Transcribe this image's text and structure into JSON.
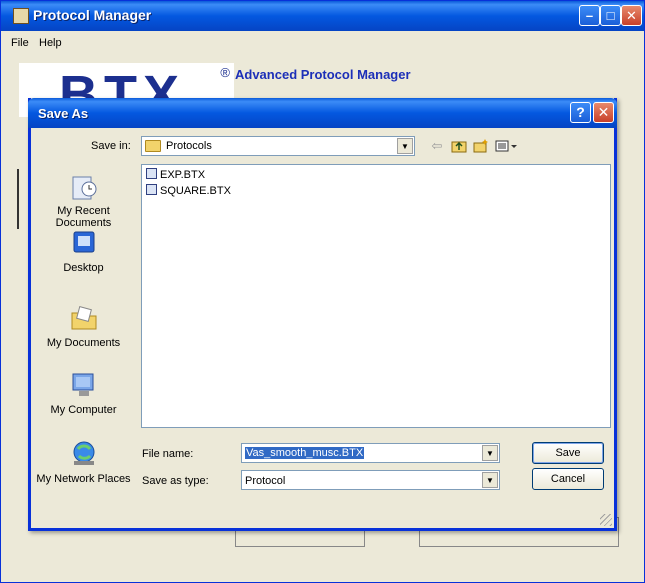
{
  "main_window": {
    "title": "Protocol Manager",
    "menu": [
      "File",
      "Help"
    ],
    "heading": "Advanced Protocol Manager",
    "logo": "BTX",
    "logo_reg": "®"
  },
  "dialog": {
    "title": "Save As",
    "help_symbol": "?",
    "close_symbol": "✕",
    "save_in_label": "Save in:",
    "save_in_value": "Protocols",
    "places": [
      "My Recent Documents",
      "Desktop",
      "My Documents",
      "My Computer",
      "My Network Places"
    ],
    "files": [
      "EXP.BTX",
      "SQUARE.BTX"
    ],
    "file_name_label": "File name:",
    "file_name_value": "Vas_smooth_musc.BTX",
    "save_as_type_label": "Save as type:",
    "save_as_type_value": "Protocol",
    "save_button": "Save",
    "cancel_button": "Cancel"
  },
  "colors": {
    "titlebar": "#0458e0",
    "dialog_border": "#0831d9",
    "selection": "#316ac5",
    "heading": "#1c2fb8"
  },
  "icons": {
    "back": "back-arrow-icon",
    "up": "up-folder-icon",
    "new_folder": "new-folder-icon",
    "views": "views-menu-icon"
  }
}
